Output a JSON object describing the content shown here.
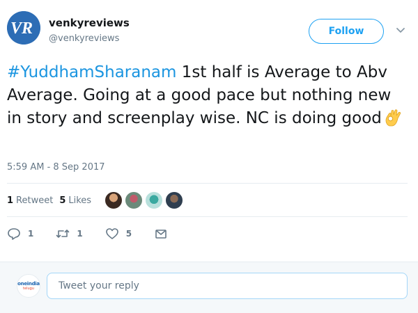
{
  "user": {
    "display_name": "venkyreviews",
    "handle": "@venkyreviews",
    "avatar_icon": "vr-logo"
  },
  "follow_button": {
    "label": "Follow"
  },
  "tweet": {
    "hashtag": "#YuddhamSharanam",
    "text": " 1st half is Average to Abv Average. Going at a good pace but nothing new in story and screenplay wise. NC is doing good",
    "emoji": "ok-hand-icon",
    "timestamp": "5:59 AM - 8 Sep 2017"
  },
  "stats": {
    "retweets_count": "1",
    "retweets_label": "Retweet",
    "likes_count": "5",
    "likes_label": "Likes"
  },
  "actions": {
    "reply_count": "1",
    "retweet_count": "1",
    "like_count": "5"
  },
  "reply": {
    "placeholder": "Tweet your reply",
    "avatar_brand": "oneindia",
    "avatar_brand_sub": "telugu"
  },
  "colors": {
    "accent": "#1da1f2",
    "hashtag": "#1b95e0",
    "muted": "#657786"
  }
}
